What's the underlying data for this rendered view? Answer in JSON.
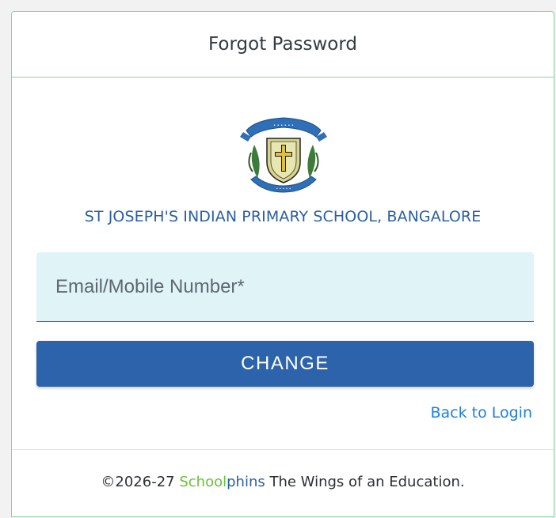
{
  "header": {
    "title": "Forgot Password"
  },
  "school": {
    "name": "ST JOSEPH'S INDIAN PRIMARY SCHOOL, BANGALORE",
    "logo_icon": "school-crest-icon"
  },
  "form": {
    "email_placeholder": "Email/Mobile Number*",
    "email_value": "",
    "submit_label": "CHANGE",
    "back_link": "Back to Login"
  },
  "footer": {
    "copyright": "©2026-27",
    "brand_part1": "School",
    "brand_part2": "phins",
    "tagline": "The Wings of an Education."
  },
  "colors": {
    "primary": "#2c63aa",
    "link": "#1e7fe0",
    "brand_green": "#67c23a",
    "border_green": "#7ed99a",
    "input_bg": "#e0f4f8"
  }
}
